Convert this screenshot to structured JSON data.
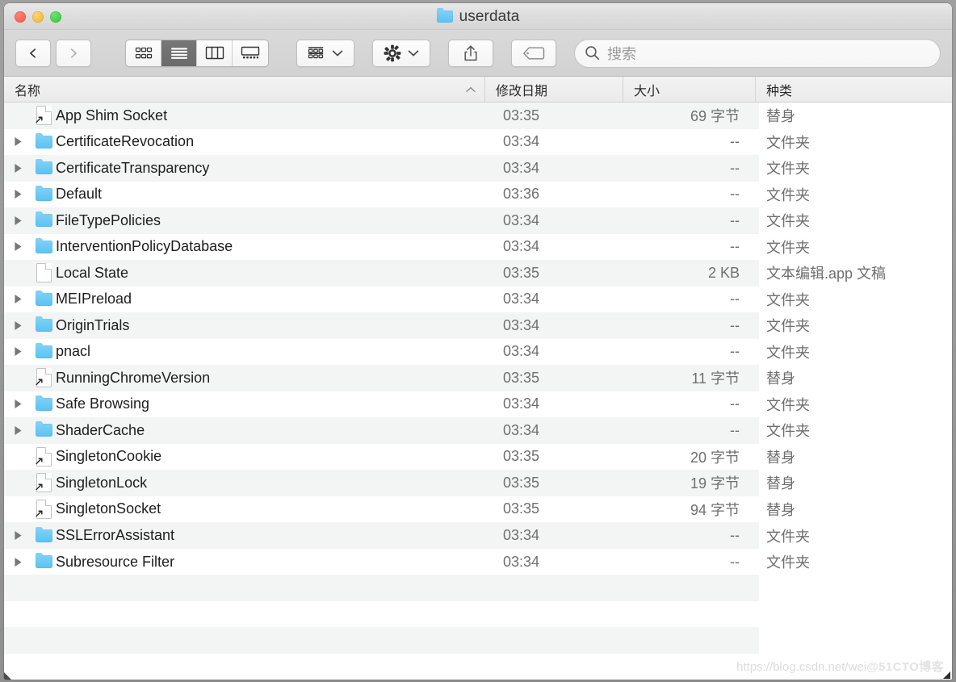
{
  "window": {
    "title": "userdata",
    "title_icon": "folder-icon",
    "traffic_lights": [
      {
        "name": "close-button",
        "color": "#f2564a"
      },
      {
        "name": "minimize-button",
        "color": "#f2b31f"
      },
      {
        "name": "maximize-button",
        "color": "#2ec62e"
      }
    ]
  },
  "toolbar": {
    "back_label": "",
    "forward_label": "",
    "back_icon": "chevron-left-icon",
    "forward_icon": "chevron-right-icon",
    "view_modes": [
      {
        "name": "icon-view",
        "icon": "grid-icon",
        "active": false
      },
      {
        "name": "list-view",
        "icon": "list-icon",
        "active": true
      },
      {
        "name": "column-view",
        "icon": "columns-icon",
        "active": false
      },
      {
        "name": "gallery-view",
        "icon": "gallery-icon",
        "active": false
      }
    ],
    "group_button": {
      "name": "group-by-button",
      "icon": "group-icon",
      "dropdown": "chevron-down-icon"
    },
    "action_button": {
      "name": "action-button",
      "icon": "gear-icon",
      "dropdown": "chevron-down-icon"
    },
    "share_button": {
      "name": "share-button",
      "icon": "share-icon"
    },
    "tag_button": {
      "name": "tag-button",
      "icon": "tag-icon"
    }
  },
  "search": {
    "placeholder": "搜索",
    "value": "",
    "icon": "search-icon"
  },
  "columns": [
    {
      "key": "name",
      "label": "名称",
      "sorted": true,
      "sort_direction": "asc"
    },
    {
      "key": "date",
      "label": "修改日期",
      "sorted": false
    },
    {
      "key": "size",
      "label": "大小",
      "sorted": false
    },
    {
      "key": "kind",
      "label": "种类",
      "sorted": false
    }
  ],
  "files": [
    {
      "name": "App Shim Socket",
      "date": "03:35",
      "size": "69 字节",
      "kind": "替身",
      "type": "alias",
      "expandable": false
    },
    {
      "name": "CertificateRevocation",
      "date": "03:34",
      "size": "--",
      "kind": "文件夹",
      "type": "folder",
      "expandable": true
    },
    {
      "name": "CertificateTransparency",
      "date": "03:34",
      "size": "--",
      "kind": "文件夹",
      "type": "folder",
      "expandable": true
    },
    {
      "name": "Default",
      "date": "03:36",
      "size": "--",
      "kind": "文件夹",
      "type": "folder",
      "expandable": true
    },
    {
      "name": "FileTypePolicies",
      "date": "03:34",
      "size": "--",
      "kind": "文件夹",
      "type": "folder",
      "expandable": true
    },
    {
      "name": "InterventionPolicyDatabase",
      "date": "03:34",
      "size": "--",
      "kind": "文件夹",
      "type": "folder",
      "expandable": true
    },
    {
      "name": "Local State",
      "date": "03:35",
      "size": "2 KB",
      "kind": "文本编辑.app 文稿",
      "type": "document",
      "expandable": false
    },
    {
      "name": "MEIPreload",
      "date": "03:34",
      "size": "--",
      "kind": "文件夹",
      "type": "folder",
      "expandable": true
    },
    {
      "name": "OriginTrials",
      "date": "03:34",
      "size": "--",
      "kind": "文件夹",
      "type": "folder",
      "expandable": true
    },
    {
      "name": "pnacl",
      "date": "03:34",
      "size": "--",
      "kind": "文件夹",
      "type": "folder",
      "expandable": true
    },
    {
      "name": "RunningChromeVersion",
      "date": "03:35",
      "size": "11 字节",
      "kind": "替身",
      "type": "alias",
      "expandable": false
    },
    {
      "name": "Safe Browsing",
      "date": "03:34",
      "size": "--",
      "kind": "文件夹",
      "type": "folder",
      "expandable": true
    },
    {
      "name": "ShaderCache",
      "date": "03:34",
      "size": "--",
      "kind": "文件夹",
      "type": "folder",
      "expandable": true
    },
    {
      "name": "SingletonCookie",
      "date": "03:35",
      "size": "20 字节",
      "kind": "替身",
      "type": "alias",
      "expandable": false
    },
    {
      "name": "SingletonLock",
      "date": "03:35",
      "size": "19 字节",
      "kind": "替身",
      "type": "alias",
      "expandable": false
    },
    {
      "name": "SingletonSocket",
      "date": "03:35",
      "size": "94 字节",
      "kind": "替身",
      "type": "alias",
      "expandable": false
    },
    {
      "name": "SSLErrorAssistant",
      "date": "03:34",
      "size": "--",
      "kind": "文件夹",
      "type": "folder",
      "expandable": true
    },
    {
      "name": "Subresource Filter",
      "date": "03:34",
      "size": "--",
      "kind": "文件夹",
      "type": "folder",
      "expandable": true
    }
  ],
  "watermark": {
    "url": "https://blog.csdn.net/wei",
    "badge": "@51CTO博客"
  },
  "colors": {
    "folder": "#59c3f2",
    "stripe": "#f3f5f5",
    "active_segment": "#6f6f6f",
    "desktop": "#9b9b9b"
  }
}
